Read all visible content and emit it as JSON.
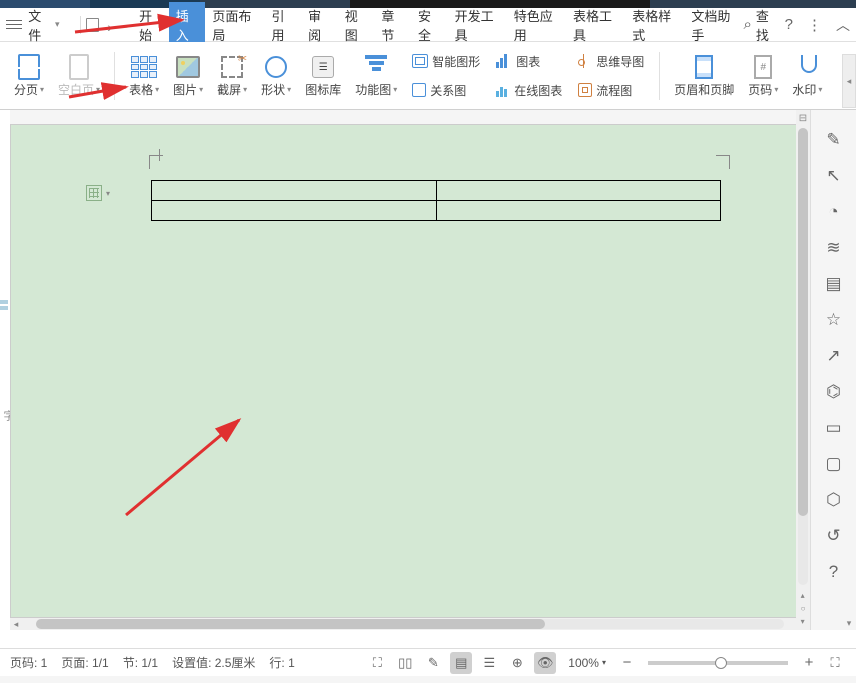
{
  "menubar": {
    "file_label": "文件",
    "tabs": [
      "开始",
      "插入",
      "页面布局",
      "引用",
      "审阅",
      "视图",
      "章节",
      "安全",
      "开发工具",
      "特色应用",
      "表格工具",
      "表格样式",
      "文档助手"
    ],
    "active_tab_index": 1,
    "search_label": "查找"
  },
  "toolbar": {
    "page_break": "分页",
    "blank_page": "空白页",
    "table": "表格",
    "image": "图片",
    "screenshot": "截屏",
    "shape": "形状",
    "icon_lib": "图标库",
    "func_graph": "功能图",
    "smart_graphic": "智能图形",
    "chart": "图表",
    "mind_map": "思维导图",
    "relation": "关系图",
    "online_chart": "在线图表",
    "flowchart": "流程图",
    "header_footer": "页眉和页脚",
    "page_number": "页码",
    "watermark": "水印"
  },
  "statusbar": {
    "page_code": "页码: 1",
    "page": "页面: 1/1",
    "section": "节: 1/1",
    "position": "设置值: 2.5厘米",
    "line": "行: 1",
    "zoom": "100%"
  },
  "side_icons": [
    "✎",
    "↖",
    "◔",
    "≋",
    "▤",
    "☆",
    "↗",
    "⌬",
    "▭",
    "▢",
    "⬡",
    "↺",
    "?"
  ],
  "left_edge_char": "字"
}
